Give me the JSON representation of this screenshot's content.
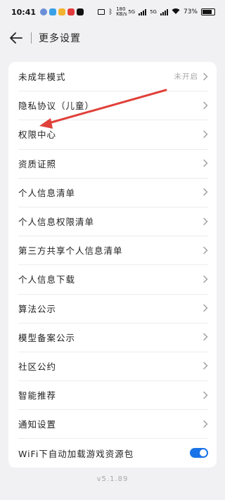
{
  "status_bar": {
    "time": "10:41",
    "network_speed": "180 KB/s",
    "network_1": "5G",
    "network_2": "5G",
    "battery": "73%"
  },
  "header": {
    "title": "更多设置"
  },
  "settings": [
    {
      "label": "未成年模式",
      "value": "未开启"
    },
    {
      "label": "隐私协议（儿童）"
    },
    {
      "label": "权限中心"
    },
    {
      "label": "资质证照"
    },
    {
      "label": "个人信息清单"
    },
    {
      "label": "个人信息权限清单"
    },
    {
      "label": "第三方共享个人信息清单"
    },
    {
      "label": "个人信息下载"
    },
    {
      "label": "算法公示"
    },
    {
      "label": "模型备案公示"
    },
    {
      "label": "社区公约"
    },
    {
      "label": "智能推荐"
    },
    {
      "label": "通知设置"
    },
    {
      "label": "WiFi下自动加载游戏资源包",
      "toggle_on": true
    }
  ],
  "footer": {
    "version": "v5.1.89"
  },
  "colors": {
    "accent": "#1a73e8",
    "annotation_arrow": "#e0413a"
  }
}
